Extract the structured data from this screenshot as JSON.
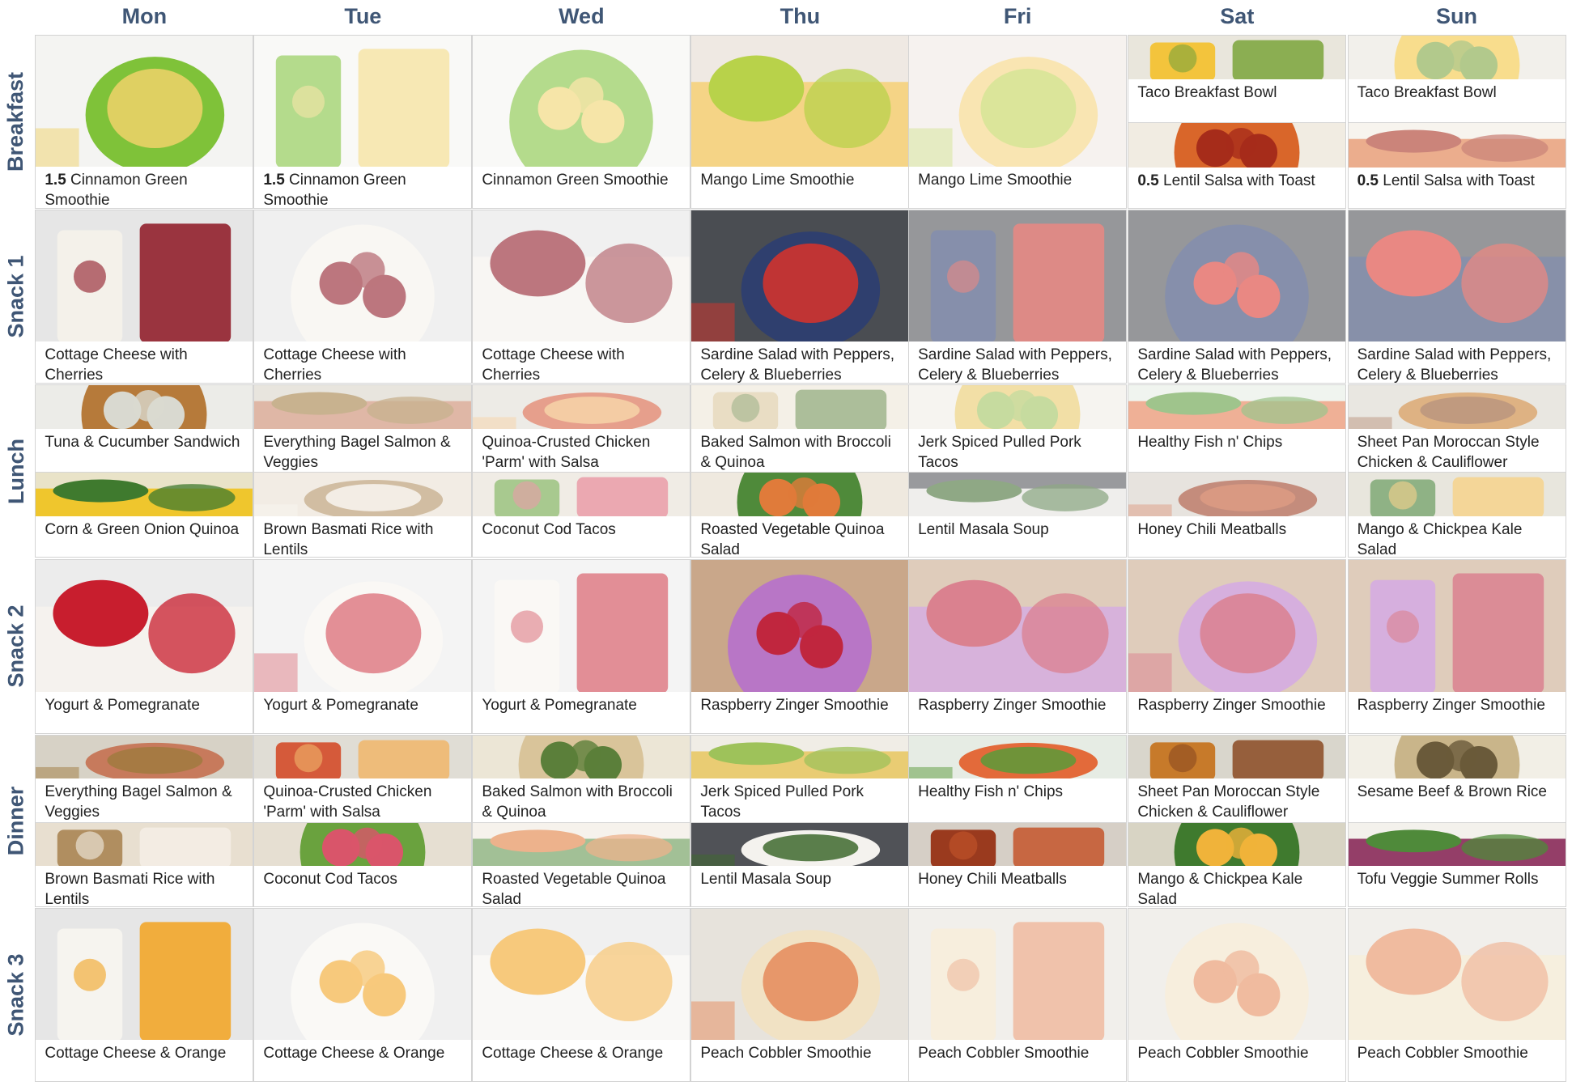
{
  "days": [
    "Mon",
    "Tue",
    "Wed",
    "Thu",
    "Fri",
    "Sat",
    "Sun"
  ],
  "rows": [
    {
      "label": "Breakfast",
      "cells": [
        [
          {
            "qty": "1.5",
            "title": "Cinnamon Green Smoothie",
            "icon": "green-smoothie-photo",
            "colors": [
              "#f4f4f2",
              "#7fc239",
              "#f0d26a"
            ]
          }
        ],
        [
          {
            "qty": "1.5",
            "title": "Cinnamon Green Smoothie",
            "icon": "green-smoothie-photo",
            "faded": true,
            "colors": [
              "#f4f4f2",
              "#7fc239",
              "#f0d26a"
            ]
          }
        ],
        [
          {
            "title": "Cinnamon Green Smoothie",
            "icon": "green-smoothie-photo",
            "faded": true,
            "colors": [
              "#f4f4f2",
              "#7fc239",
              "#f0d26a"
            ]
          }
        ],
        [
          {
            "title": "Mango Lime Smoothie",
            "icon": "mango-smoothie-photo",
            "colors": [
              "#efe9e3",
              "#f5d27b",
              "#b8d24a"
            ]
          }
        ],
        [
          {
            "title": "Mango Lime Smoothie",
            "icon": "mango-smoothie-photo",
            "faded": true,
            "colors": [
              "#efe9e3",
              "#f5d27b",
              "#b8d24a"
            ]
          }
        ],
        [
          {
            "title": "Taco Breakfast Bowl",
            "icon": "taco-bowl-photo",
            "colors": [
              "#e9e6dc",
              "#f3c43c",
              "#7aa33a"
            ]
          },
          {
            "qty": "0.5",
            "title": "Lentil Salsa with Toast",
            "icon": "lentil-salsa-photo",
            "colors": [
              "#f1ece2",
              "#d9662a",
              "#a62c1a"
            ]
          }
        ],
        [
          {
            "title": "Taco Breakfast Bowl",
            "icon": "taco-bowl-photo",
            "faded": true,
            "colors": [
              "#e9e6dc",
              "#f3c43c",
              "#7aa33a"
            ]
          },
          {
            "qty": "0.5",
            "title": "Lentil Salsa with Toast",
            "icon": "lentil-salsa-photo",
            "faded": true,
            "colors": [
              "#f1ece2",
              "#d9662a",
              "#a62c1a"
            ]
          }
        ]
      ]
    },
    {
      "label": "Snack 1",
      "cells": [
        [
          {
            "title": "Cottage Cheese with Cherries",
            "icon": "cottage-cherries-photo",
            "colors": [
              "#e6e6e6",
              "#f4f1ea",
              "#8c1421"
            ]
          }
        ],
        [
          {
            "title": "Cottage Cheese with Cherries",
            "icon": "cottage-cherries-photo",
            "faded": true,
            "colors": [
              "#e6e6e6",
              "#f4f1ea",
              "#8c1421"
            ]
          }
        ],
        [
          {
            "title": "Cottage Cheese with Cherries",
            "icon": "cottage-cherries-photo",
            "faded": true,
            "colors": [
              "#e6e6e6",
              "#f4f1ea",
              "#8c1421"
            ]
          }
        ],
        [
          {
            "title": "Sardine Salad with Peppers, Celery & Blueberries",
            "icon": "sardine-box-photo",
            "colors": [
              "#4a4d52",
              "#2f3f6e",
              "#d9332a"
            ]
          }
        ],
        [
          {
            "title": "Sardine Salad with Peppers, Celery & Blueberries",
            "icon": "sardine-box-photo",
            "faded": true,
            "colors": [
              "#4a4d52",
              "#2f3f6e",
              "#d9332a"
            ]
          }
        ],
        [
          {
            "title": "Sardine Salad with Peppers, Celery & Blueberries",
            "icon": "sardine-box-photo",
            "faded": true,
            "colors": [
              "#4a4d52",
              "#2f3f6e",
              "#d9332a"
            ]
          }
        ],
        [
          {
            "title": "Sardine Salad with Peppers, Celery & Blueberries",
            "icon": "sardine-box-photo",
            "faded": true,
            "colors": [
              "#4a4d52",
              "#2f3f6e",
              "#d9332a"
            ]
          }
        ]
      ]
    },
    {
      "label": "Lunch",
      "cells": [
        [
          {
            "title": "Tuna & Cucumber Sandwich",
            "icon": "sandwich-photo",
            "colors": [
              "#ecece8",
              "#b67a3a",
              "#d9d9d0"
            ]
          },
          {
            "title": "Corn & Green Onion Quinoa",
            "icon": "corn-quinoa-photo",
            "colors": [
              "#e9e3c8",
              "#f0c21c",
              "#3f7a2e"
            ]
          }
        ],
        [
          {
            "title": "Everything Bagel Salmon & Veggies",
            "icon": "salmon-veggies-photo",
            "faded": true,
            "colors": [
              "#d7d2c6",
              "#c77a5c",
              "#a07a3e"
            ]
          },
          {
            "title": "Brown Basmati Rice with Lentils",
            "icon": "rice-lentils-photo",
            "faded": true,
            "colors": [
              "#e8dfd0",
              "#b08e60",
              "#f4efe6"
            ]
          }
        ],
        [
          {
            "title": "Quinoa-Crusted Chicken 'Parm' with Salsa",
            "icon": "chicken-parm-photo",
            "faded": true,
            "colors": [
              "#e0ddd5",
              "#d55a3a",
              "#f0b66a"
            ]
          },
          {
            "title": "Coconut Cod Tacos",
            "icon": "cod-tacos-photo",
            "faded": true,
            "colors": [
              "#e6dfd2",
              "#6aa23e",
              "#d9556a"
            ]
          }
        ],
        [
          {
            "title": "Baked Salmon with Broccoli & Quinoa",
            "icon": "baked-salmon-photo",
            "faded": true,
            "colors": [
              "#ece6d6",
              "#d9c49a",
              "#5b7f3a"
            ]
          },
          {
            "title": "Roasted Vegetable Quinoa Salad",
            "icon": "veg-quinoa-salad-photo",
            "colors": [
              "#efe9df",
              "#4f8a3a",
              "#e07b3a"
            ]
          }
        ],
        [
          {
            "title": "Jerk Spiced Pulled Pork Tacos",
            "icon": "pork-tacos-photo",
            "faded": true,
            "colors": [
              "#f0ede6",
              "#e8c866",
              "#9ec25a"
            ]
          },
          {
            "title": "Lentil Masala Soup",
            "icon": "lentil-soup-photo",
            "faded": true,
            "colors": [
              "#505257",
              "#f4f2ee",
              "#3e6a2e"
            ]
          }
        ],
        [
          {
            "title": "Healthy Fish n' Chips",
            "icon": "fish-chips-photo",
            "faded": true,
            "colors": [
              "#e6ece4",
              "#e36a3a",
              "#5a9a3a"
            ]
          },
          {
            "title": "Honey Chili Meatballs",
            "icon": "meatballs-photo",
            "faded": true,
            "colors": [
              "#d6cfc6",
              "#9a3a1e",
              "#c4552a"
            ]
          }
        ],
        [
          {
            "title": "Sheet Pan Moroccan Style Chicken & Cauliflower",
            "icon": "moroccan-chicken-photo",
            "faded": true,
            "colors": [
              "#d9d6cc",
              "#c77a2a",
              "#8a4a22"
            ]
          },
          {
            "title": "Mango & Chickpea Kale Salad",
            "icon": "kale-salad-photo",
            "faded": true,
            "colors": [
              "#d8d4c4",
              "#3f7a2e",
              "#f0b33a"
            ]
          }
        ]
      ]
    },
    {
      "label": "Snack 2",
      "cells": [
        [
          {
            "title": "Yogurt & Pomegranate",
            "icon": "yogurt-pomegranate-photo",
            "colors": [
              "#ececec",
              "#f6f3ee",
              "#c81e2e"
            ]
          }
        ],
        [
          {
            "title": "Yogurt & Pomegranate",
            "icon": "yogurt-pomegranate-photo",
            "faded": true,
            "colors": [
              "#ececec",
              "#f6f3ee",
              "#c81e2e"
            ]
          }
        ],
        [
          {
            "title": "Yogurt & Pomegranate",
            "icon": "yogurt-pomegranate-photo",
            "faded": true,
            "colors": [
              "#ececec",
              "#f6f3ee",
              "#c81e2e"
            ]
          }
        ],
        [
          {
            "title": "Raspberry Zinger Smoothie",
            "icon": "raspberry-smoothie-photo",
            "colors": [
              "#c9a78a",
              "#b876c6",
              "#c0263e"
            ]
          }
        ],
        [
          {
            "title": "Raspberry Zinger Smoothie",
            "icon": "raspberry-smoothie-photo",
            "faded": true,
            "colors": [
              "#c9a78a",
              "#b876c6",
              "#c0263e"
            ]
          }
        ],
        [
          {
            "title": "Raspberry Zinger Smoothie",
            "icon": "raspberry-smoothie-photo",
            "faded": true,
            "colors": [
              "#c9a78a",
              "#b876c6",
              "#c0263e"
            ]
          }
        ],
        [
          {
            "title": "Raspberry Zinger Smoothie",
            "icon": "raspberry-smoothie-photo",
            "faded": true,
            "colors": [
              "#c9a78a",
              "#b876c6",
              "#c0263e"
            ]
          }
        ]
      ]
    },
    {
      "label": "Dinner",
      "cells": [
        [
          {
            "title": "Everything Bagel Salmon & Veggies",
            "icon": "salmon-veggies-photo",
            "colors": [
              "#d7d2c6",
              "#c77a5c",
              "#a07a3e"
            ]
          },
          {
            "title": "Brown Basmati Rice with Lentils",
            "icon": "rice-lentils-photo",
            "colors": [
              "#e8dfd0",
              "#b08e60",
              "#f4efe6"
            ]
          }
        ],
        [
          {
            "title": "Quinoa-Crusted Chicken 'Parm' with Salsa",
            "icon": "chicken-parm-photo",
            "colors": [
              "#e0ddd5",
              "#d55a3a",
              "#f0b66a"
            ]
          },
          {
            "title": "Coconut Cod Tacos",
            "icon": "cod-tacos-photo",
            "colors": [
              "#e6dfd2",
              "#6aa23e",
              "#d9556a"
            ]
          }
        ],
        [
          {
            "title": "Baked Salmon with Broccoli & Quinoa",
            "icon": "baked-salmon-photo",
            "colors": [
              "#ece6d6",
              "#d9c49a",
              "#5b7f3a"
            ]
          },
          {
            "title": "Roasted Vegetable Quinoa Salad",
            "icon": "veg-quinoa-salad-photo",
            "faded": true,
            "colors": [
              "#efe9df",
              "#4f8a3a",
              "#e07b3a"
            ]
          }
        ],
        [
          {
            "title": "Jerk Spiced Pulled Pork Tacos",
            "icon": "pork-tacos-photo",
            "colors": [
              "#f0ede6",
              "#e8c866",
              "#9ec25a"
            ]
          },
          {
            "title": "Lentil Masala Soup",
            "icon": "lentil-soup-photo",
            "colors": [
              "#505257",
              "#f4f2ee",
              "#3e6a2e"
            ]
          }
        ],
        [
          {
            "title": "Healthy Fish n' Chips",
            "icon": "fish-chips-photo",
            "colors": [
              "#e6ece4",
              "#e36a3a",
              "#5a9a3a"
            ]
          },
          {
            "title": "Honey Chili Meatballs",
            "icon": "meatballs-photo",
            "colors": [
              "#d6cfc6",
              "#9a3a1e",
              "#c4552a"
            ]
          }
        ],
        [
          {
            "title": "Sheet Pan Moroccan Style Chicken & Cauliflower",
            "icon": "moroccan-chicken-photo",
            "colors": [
              "#d9d6cc",
              "#c77a2a",
              "#8a4a22"
            ]
          },
          {
            "title": "Mango & Chickpea Kale Salad",
            "icon": "kale-salad-photo",
            "colors": [
              "#d8d4c4",
              "#3f7a2e",
              "#f0b33a"
            ]
          }
        ],
        [
          {
            "title": "Sesame Beef & Brown Rice",
            "icon": "sesame-beef-photo",
            "colors": [
              "#f2efe6",
              "#c9b58a",
              "#6a5a3a"
            ]
          },
          {
            "title": "Tofu Veggie Summer Rolls",
            "icon": "summer-rolls-photo",
            "colors": [
              "#f3f1ec",
              "#8a2a5a",
              "#4f8a3a"
            ]
          }
        ]
      ]
    },
    {
      "label": "Snack 3",
      "cells": [
        [
          {
            "title": "Cottage Cheese & Orange",
            "icon": "cottage-orange-photo",
            "colors": [
              "#e6e6e6",
              "#f6f4ef",
              "#f2a21e"
            ]
          }
        ],
        [
          {
            "title": "Cottage Cheese & Orange",
            "icon": "cottage-orange-photo",
            "faded": true,
            "colors": [
              "#e6e6e6",
              "#f6f4ef",
              "#f2a21e"
            ]
          }
        ],
        [
          {
            "title": "Cottage Cheese & Orange",
            "icon": "cottage-orange-photo",
            "faded": true,
            "colors": [
              "#e6e6e6",
              "#f6f4ef",
              "#f2a21e"
            ]
          }
        ],
        [
          {
            "title": "Peach Cobbler Smoothie",
            "icon": "peach-smoothie-photo",
            "colors": [
              "#e7e3dc",
              "#f1e2c4",
              "#e58a5a"
            ]
          }
        ],
        [
          {
            "title": "Peach Cobbler Smoothie",
            "icon": "peach-smoothie-photo",
            "faded": true,
            "colors": [
              "#e7e3dc",
              "#f1e2c4",
              "#e58a5a"
            ]
          }
        ],
        [
          {
            "title": "Peach Cobbler Smoothie",
            "icon": "peach-smoothie-photo",
            "faded": true,
            "colors": [
              "#e7e3dc",
              "#f1e2c4",
              "#e58a5a"
            ]
          }
        ],
        [
          {
            "title": "Peach Cobbler Smoothie",
            "icon": "peach-smoothie-photo",
            "faded": true,
            "colors": [
              "#e7e3dc",
              "#f1e2c4",
              "#e58a5a"
            ]
          }
        ]
      ]
    }
  ]
}
